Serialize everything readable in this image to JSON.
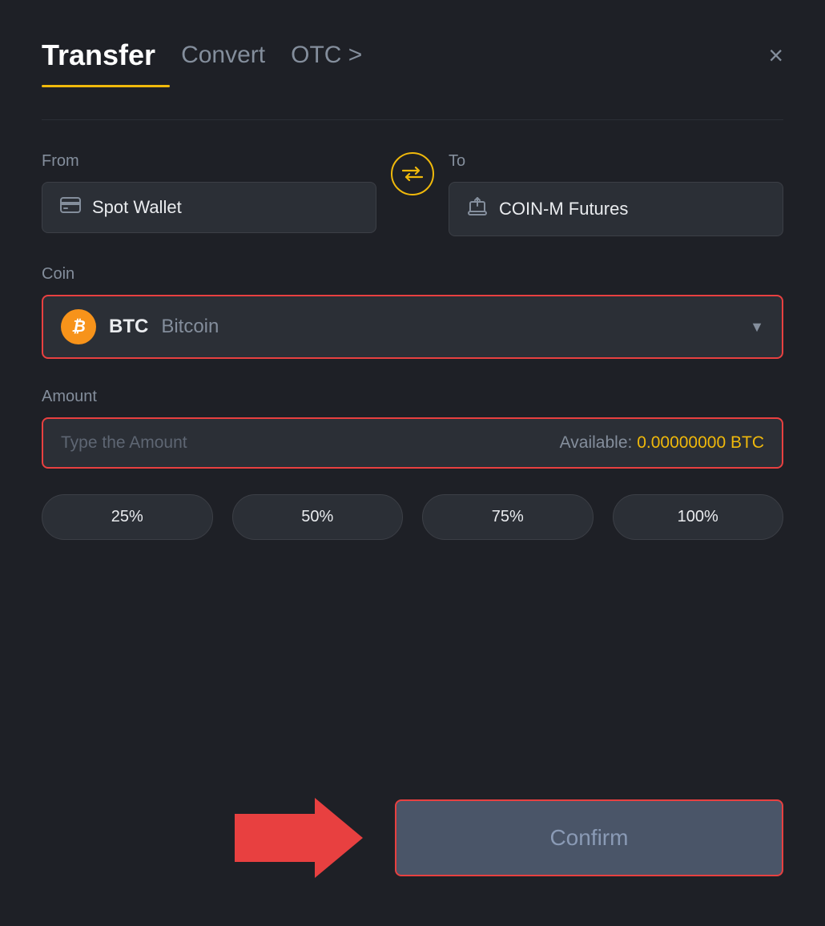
{
  "header": {
    "active_tab": "Transfer",
    "tabs": [
      {
        "label": "Transfer",
        "active": true
      },
      {
        "label": "Convert",
        "active": false
      },
      {
        "label": "OTC >",
        "active": false
      }
    ],
    "close_label": "×"
  },
  "from": {
    "label": "From",
    "wallet_label": "Spot Wallet",
    "icon": "card-icon"
  },
  "to": {
    "label": "To",
    "wallet_label": "COIN-M Futures",
    "icon": "transfer-icon"
  },
  "swap": {
    "icon": "swap-icon"
  },
  "coin": {
    "label": "Coin",
    "symbol": "BTC",
    "name": "Bitcoin",
    "icon": "btc-icon"
  },
  "amount": {
    "label": "Amount",
    "placeholder": "Type the Amount",
    "available_label": "Available:",
    "available_value": "0.00000000",
    "available_unit": "BTC"
  },
  "percentages": [
    {
      "label": "25%",
      "value": 25
    },
    {
      "label": "50%",
      "value": 50
    },
    {
      "label": "75%",
      "value": 75
    },
    {
      "label": "100%",
      "value": 100
    }
  ],
  "confirm_button": {
    "label": "Confirm"
  },
  "colors": {
    "accent": "#f0b90b",
    "danger": "#e84040",
    "bg": "#1e2026",
    "surface": "#2b2f36"
  }
}
